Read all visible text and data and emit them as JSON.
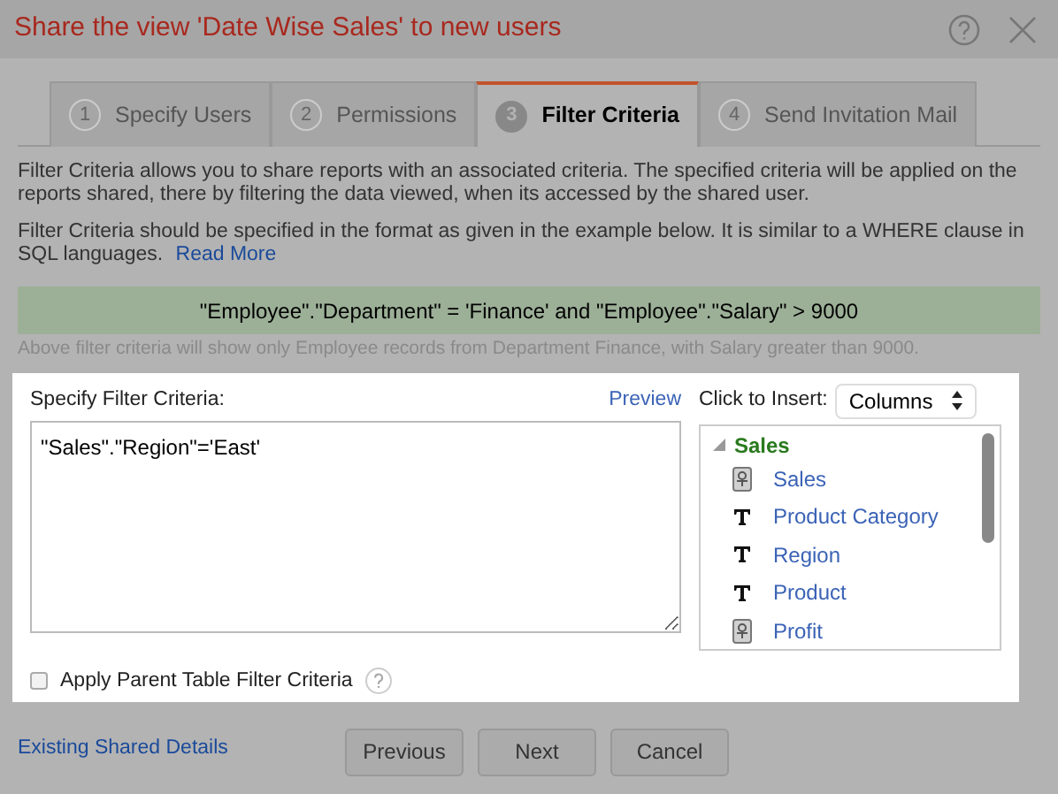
{
  "window": {
    "title": "Share the view 'Date Wise Sales' to new users"
  },
  "tabs": [
    {
      "number": "1",
      "label": "Specify Users",
      "selected": false
    },
    {
      "number": "2",
      "label": "Permissions",
      "selected": false
    },
    {
      "number": "3",
      "label": "Filter Criteria",
      "selected": true
    },
    {
      "number": "4",
      "label": "Send Invitation Mail",
      "selected": false
    }
  ],
  "intro": "Filter Criteria allows you to share reports with an associated criteria. The specified criteria will be applied on the reports shared, there by filtering the data viewed, when its accessed by the shared user.",
  "format_note": "Filter Criteria should be specified in the format as given in the example below. It is similar to a WHERE clause in SQL languages.",
  "read_more": "Read More",
  "example": "\"Employee\".\"Department\" = 'Finance' and \"Employee\".\"Salary\" > 9000",
  "example_note": "Above filter criteria will show only Employee records from Department Finance, with Salary greater than 9000.",
  "criteria": {
    "label": "Specify Filter Criteria:",
    "preview": "Preview",
    "value": "\"Sales\".\"Region\"='East'"
  },
  "insert": {
    "label": "Click to Insert:",
    "select": "Columns"
  },
  "tree": {
    "label": "Sales",
    "expanded": true,
    "children": [
      {
        "label": "Sales",
        "kind": "measure"
      },
      {
        "label": "Product Category",
        "kind": "text"
      },
      {
        "label": "Region",
        "kind": "text"
      },
      {
        "label": "Product",
        "kind": "text"
      },
      {
        "label": "Profit",
        "kind": "measure"
      }
    ]
  },
  "apply_parent": {
    "label": "Apply Parent Table Filter Criteria",
    "checked": false
  },
  "existing_link": "Existing Shared Details",
  "buttons": [
    "Previous",
    "Next",
    "Cancel"
  ]
}
